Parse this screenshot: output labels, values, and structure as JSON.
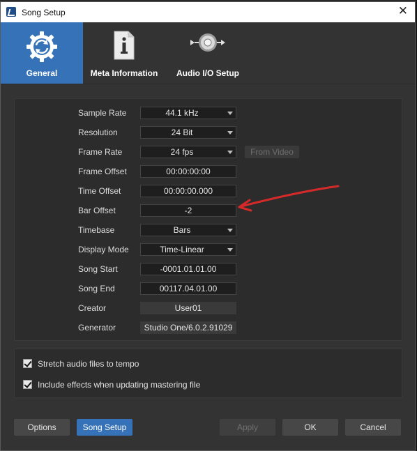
{
  "window": {
    "title": "Song Setup"
  },
  "tabs": [
    {
      "label": "General",
      "icon": "gear-sync-icon",
      "active": true
    },
    {
      "label": "Meta Information",
      "icon": "document-info-icon",
      "active": false
    },
    {
      "label": "Audio I/O Setup",
      "icon": "audio-io-icon",
      "active": false
    }
  ],
  "settings": {
    "sample_rate": {
      "label": "Sample Rate",
      "value": "44.1 kHz"
    },
    "resolution": {
      "label": "Resolution",
      "value": "24 Bit"
    },
    "frame_rate": {
      "label": "Frame Rate",
      "value": "24 fps",
      "from_video": "From Video"
    },
    "frame_offset": {
      "label": "Frame Offset",
      "value": "00:00:00:00"
    },
    "time_offset": {
      "label": "Time Offset",
      "value": "00:00:00.000"
    },
    "bar_offset": {
      "label": "Bar Offset",
      "value": "-2"
    },
    "timebase": {
      "label": "Timebase",
      "value": "Bars"
    },
    "display_mode": {
      "label": "Display Mode",
      "value": "Time-Linear"
    },
    "song_start": {
      "label": "Song Start",
      "value": "-0001.01.01.00"
    },
    "song_end": {
      "label": "Song End",
      "value": "00117.04.01.00"
    },
    "creator": {
      "label": "Creator",
      "value": "User01"
    },
    "generator": {
      "label": "Generator",
      "value": "Studio One/6.0.2.91029"
    }
  },
  "options": {
    "stretch_audio": {
      "label": "Stretch audio files to tempo",
      "checked": true
    },
    "include_effects": {
      "label": "Include effects when updating mastering file",
      "checked": true
    }
  },
  "buttons": {
    "options": "Options",
    "song_setup": "Song Setup",
    "apply": "Apply",
    "ok": "OK",
    "cancel": "Cancel"
  },
  "colors": {
    "accent": "#3672b8",
    "annotation_arrow": "#d42a2a"
  }
}
